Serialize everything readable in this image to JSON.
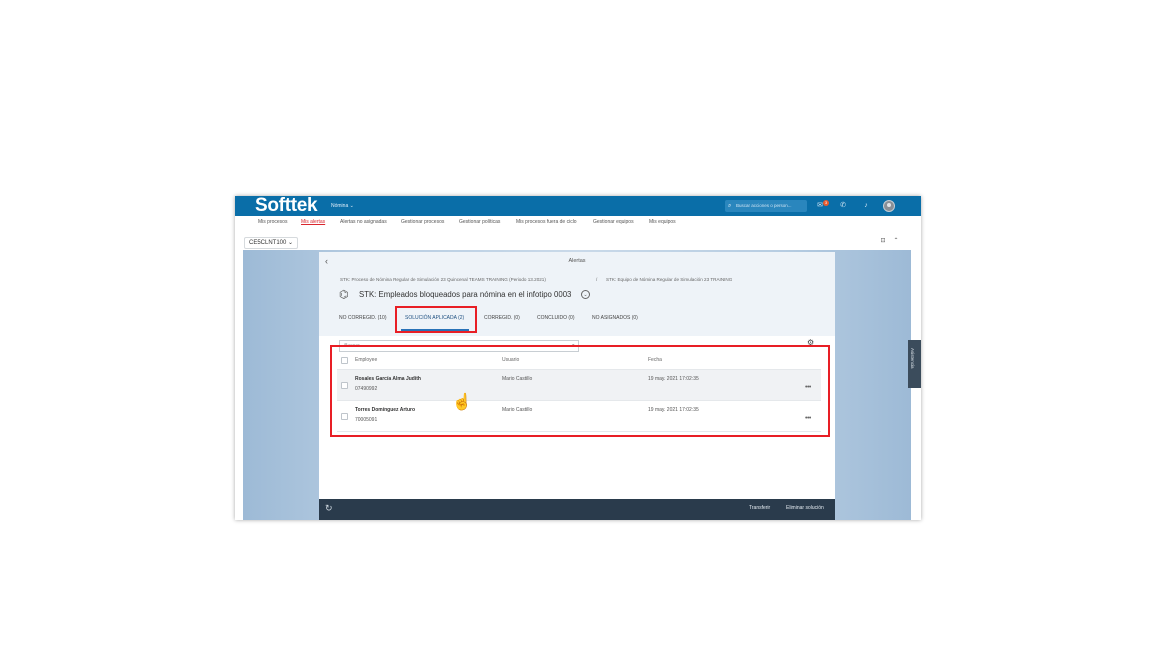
{
  "shell": {
    "logo": "Softtek",
    "app_switch": "Nómina ⌄",
    "search_placeholder": "Buscar acciones o person...",
    "notification_count": "3"
  },
  "nav": {
    "items": [
      "Mis procesos",
      "Mis alertas",
      "Alertas no asignadas",
      "Gestionar procesos",
      "Gestionar políticas",
      "Mis procesos fuera de ciclo",
      "Gestionar equipos",
      "Mis equipos"
    ],
    "active": "Mis alertas"
  },
  "client_selector": "CE5CLNT100 ⌄",
  "panel": {
    "title": "Alertas",
    "breadcrumb_1": "STK: Proceso de Nómina Regular de Simulación 23 Quincenal TEAMS TRAINING (Periodo 13.2021)",
    "breadcrumb_sep": "/",
    "breadcrumb_2": "STK: Equipo de Nómina Regular de Simulación 23 TRAINING",
    "object_title": "STK: Empleados bloqueados para nómina en el infotipo 0003",
    "tabs": [
      "NO CORREGID. (10)",
      "SOLUCIÓN APLICADA (2)",
      "CORREGID. (0)",
      "CONCLUIDO (0)",
      "NO ASIGNADOS (0)"
    ],
    "selected_tab": "SOLUCIÓN APLICADA (2)",
    "search_placeholder": "Buscar"
  },
  "table": {
    "columns": [
      "Employee",
      "Usuario",
      "Fecha"
    ],
    "rows": [
      {
        "name": "Rosales García Alma Judith",
        "id": "07490992",
        "user": "Mario Castillo",
        "date": "19 may. 2021 17:02:35"
      },
      {
        "name": "Torres Domínguez Arturo",
        "id": "70005091",
        "user": "Mario Castillo",
        "date": "19 may. 2021 17:02:35"
      }
    ]
  },
  "footer": {
    "transfer": "Transferir",
    "delete": "Eliminar solución"
  },
  "side_tab": "Asistencia"
}
